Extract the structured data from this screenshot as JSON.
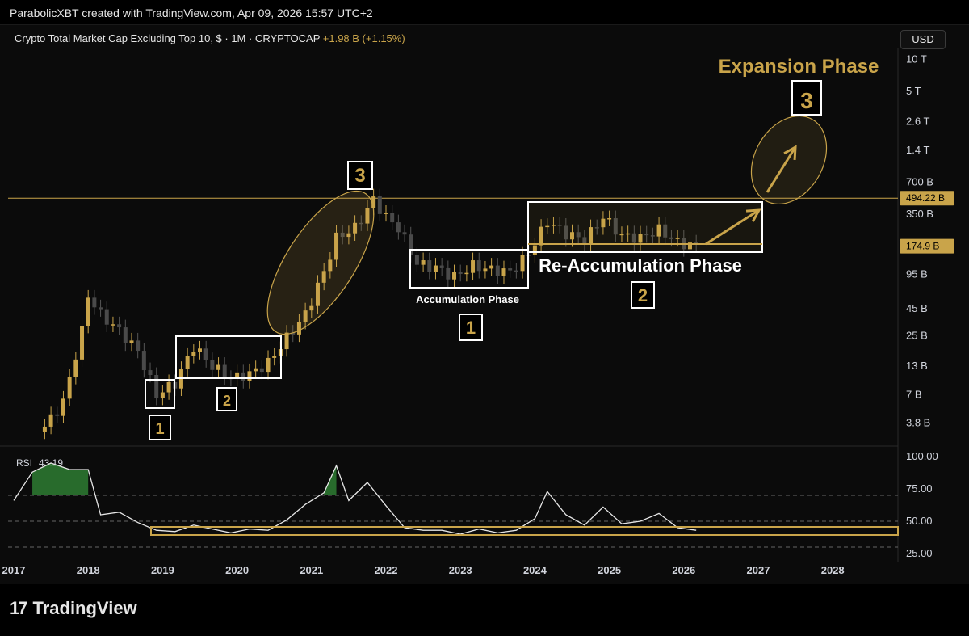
{
  "header": {
    "credit": "ParabolicXBT created with TradingView.com, Apr 09, 2026 15:57 UTC+2",
    "title": "Crypto Total Market Cap Excluding Top 10, $ · 1M · CRYPTOCAP",
    "change": "+1.98 B (+1.15%)",
    "currency": "USD"
  },
  "brand": {
    "logo": "17",
    "name": "TradingView"
  },
  "colors": {
    "accent": "#c9a44a",
    "up": "#c9a44a",
    "down": "#505050",
    "rsi_fill": "#2e7d32"
  },
  "chart_data": [
    {
      "type": "candlestick",
      "title": "Crypto Total Market Cap Excluding Top 10",
      "scale": "log",
      "y_ticks": [
        "10 T",
        "5 T",
        "2.6 T",
        "1.4 T",
        "700 B",
        "350 B",
        "95 B",
        "45 B",
        "25 B",
        "13 B",
        "7 B",
        "3.8 B"
      ],
      "x_ticks": [
        "2017",
        "2018",
        "2019",
        "2020",
        "2021",
        "2022",
        "2023",
        "2024",
        "2025",
        "2026",
        "2027",
        "2028"
      ],
      "price_labels": [
        {
          "label": "494.22 B",
          "value": 494.22
        },
        {
          "label": "174.9 B",
          "value": 174.9
        }
      ],
      "close_series_billion": [
        {
          "date": "2017-06",
          "close": 3.5
        },
        {
          "date": "2017-09",
          "close": 6
        },
        {
          "date": "2017-12",
          "close": 28
        },
        {
          "date": "2018-01",
          "close": 60
        },
        {
          "date": "2018-03",
          "close": 40
        },
        {
          "date": "2018-06",
          "close": 28
        },
        {
          "date": "2018-09",
          "close": 18
        },
        {
          "date": "2018-12",
          "close": 7
        },
        {
          "date": "2019-03",
          "close": 9
        },
        {
          "date": "2019-06",
          "close": 20
        },
        {
          "date": "2019-09",
          "close": 13
        },
        {
          "date": "2019-12",
          "close": 10
        },
        {
          "date": "2020-03",
          "close": 11
        },
        {
          "date": "2020-06",
          "close": 14
        },
        {
          "date": "2020-09",
          "close": 24
        },
        {
          "date": "2020-12",
          "close": 40
        },
        {
          "date": "2021-03",
          "close": 100
        },
        {
          "date": "2021-05",
          "close": 210
        },
        {
          "date": "2021-08",
          "close": 260
        },
        {
          "date": "2021-11",
          "close": 480
        },
        {
          "date": "2022-01",
          "close": 330
        },
        {
          "date": "2022-03",
          "close": 260
        },
        {
          "date": "2022-06",
          "close": 120
        },
        {
          "date": "2022-09",
          "close": 110
        },
        {
          "date": "2022-12",
          "close": 90
        },
        {
          "date": "2023-03",
          "close": 115
        },
        {
          "date": "2023-06",
          "close": 105
        },
        {
          "date": "2023-09",
          "close": 100
        },
        {
          "date": "2023-12",
          "close": 150
        },
        {
          "date": "2024-03",
          "close": 300
        },
        {
          "date": "2024-06",
          "close": 230
        },
        {
          "date": "2024-09",
          "close": 200
        },
        {
          "date": "2024-12",
          "close": 330
        },
        {
          "date": "2025-03",
          "close": 220
        },
        {
          "date": "2025-06",
          "close": 210
        },
        {
          "date": "2025-09",
          "close": 250
        },
        {
          "date": "2025-12",
          "close": 190
        },
        {
          "date": "2026-03",
          "close": 175
        }
      ],
      "annotations": [
        {
          "text": "Accumulation Phase",
          "marker": "1"
        },
        {
          "text": "Re-Accumulation Phase",
          "marker": "2"
        },
        {
          "text": "Expansion Phase",
          "marker": "3"
        }
      ],
      "cycle_markers": [
        "1",
        "2",
        "3",
        "1",
        "2",
        "3"
      ]
    },
    {
      "type": "line",
      "title": "RSI",
      "value_label": "43.19",
      "y_ticks": [
        "100.00",
        "75.00",
        "50.00",
        "25.00"
      ],
      "ylim": [
        25,
        100
      ],
      "levels": [
        70,
        50,
        30
      ],
      "series": [
        {
          "name": "RSI",
          "points": [
            {
              "date": "2017-01",
              "value": 66
            },
            {
              "date": "2017-04",
              "value": 88
            },
            {
              "date": "2017-07",
              "value": 95
            },
            {
              "date": "2017-10",
              "value": 90
            },
            {
              "date": "2018-01",
              "value": 90
            },
            {
              "date": "2018-03",
              "value": 55
            },
            {
              "date": "2018-06",
              "value": 57
            },
            {
              "date": "2018-09",
              "value": 49
            },
            {
              "date": "2018-12",
              "value": 43
            },
            {
              "date": "2019-03",
              "value": 42
            },
            {
              "date": "2019-06",
              "value": 47
            },
            {
              "date": "2019-09",
              "value": 44
            },
            {
              "date": "2019-12",
              "value": 41
            },
            {
              "date": "2020-03",
              "value": 44
            },
            {
              "date": "2020-06",
              "value": 43
            },
            {
              "date": "2020-09",
              "value": 51
            },
            {
              "date": "2020-12",
              "value": 63
            },
            {
              "date": "2021-03",
              "value": 72
            },
            {
              "date": "2021-05",
              "value": 93
            },
            {
              "date": "2021-07",
              "value": 66
            },
            {
              "date": "2021-10",
              "value": 80
            },
            {
              "date": "2022-01",
              "value": 62
            },
            {
              "date": "2022-04",
              "value": 45
            },
            {
              "date": "2022-07",
              "value": 43
            },
            {
              "date": "2022-10",
              "value": 43
            },
            {
              "date": "2023-01",
              "value": 40
            },
            {
              "date": "2023-04",
              "value": 44
            },
            {
              "date": "2023-07",
              "value": 41
            },
            {
              "date": "2023-10",
              "value": 43
            },
            {
              "date": "2024-01",
              "value": 52
            },
            {
              "date": "2024-03",
              "value": 73
            },
            {
              "date": "2024-06",
              "value": 55
            },
            {
              "date": "2024-09",
              "value": 47
            },
            {
              "date": "2024-12",
              "value": 61
            },
            {
              "date": "2025-03",
              "value": 48
            },
            {
              "date": "2025-06",
              "value": 50
            },
            {
              "date": "2025-09",
              "value": 56
            },
            {
              "date": "2025-12",
              "value": 45
            },
            {
              "date": "2026-03",
              "value": 43
            }
          ]
        }
      ]
    }
  ]
}
